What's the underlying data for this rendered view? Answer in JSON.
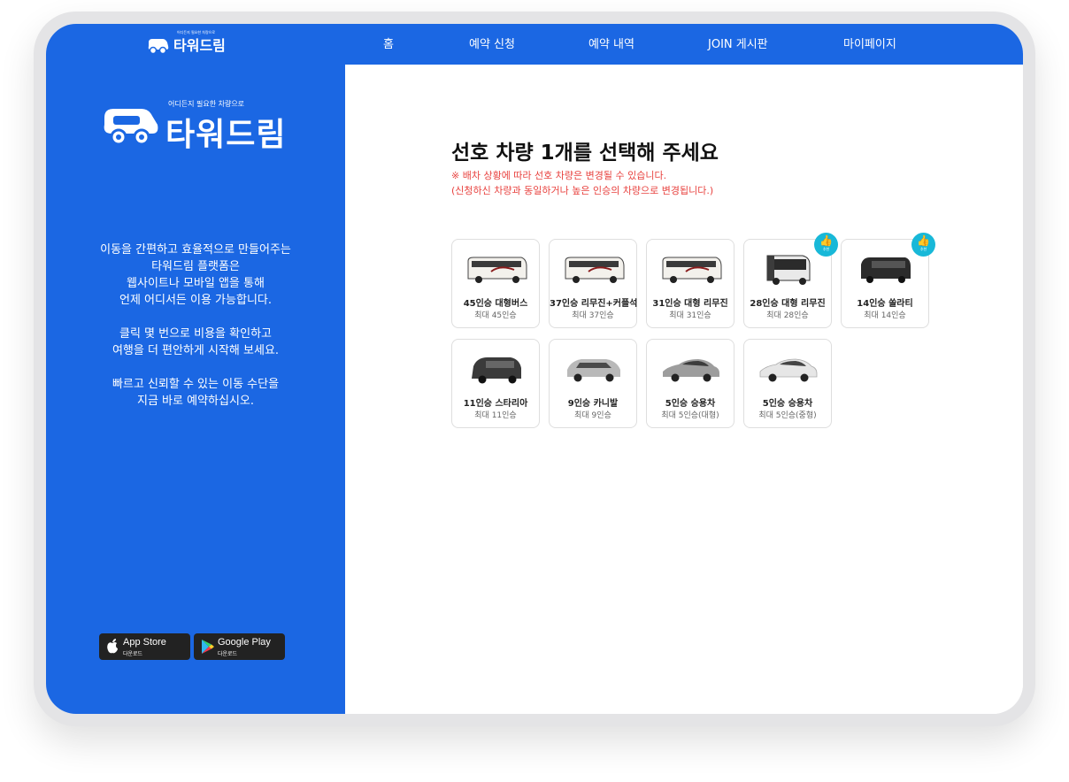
{
  "brand": {
    "name": "타워드림",
    "tagline": "어디든지 필요한 차량으로"
  },
  "nav": {
    "items": [
      "홈",
      "예약 신청",
      "예약 내역",
      "JOIN 게시판",
      "마이페이지"
    ]
  },
  "sidebar": {
    "paragraphs": [
      "이동을 간편하고 효율적으로 만들어주는\n타워드림 플랫폼은\n웹사이트나 모바일 앱을 통해\n언제 어디서든 이용 가능합니다.",
      "클릭 몇 번으로 비용을 확인하고\n여행을 더 편안하게 시작해 보세요.",
      "빠르고 신뢰할 수 있는 이동 수단을\n지금 바로 예약하십시오."
    ],
    "stores": [
      {
        "title": "App Store",
        "sub": "다운로드",
        "icon": "apple-icon"
      },
      {
        "title": "Google Play",
        "sub": "다운로드",
        "icon": "google-play-icon"
      }
    ]
  },
  "main": {
    "heading": "선호 차량 1개를 선택해 주세요",
    "notice_1": "※ 배차 상황에 따라 선호 차량은 변경될 수 있습니다.",
    "notice_2": "(신청하신 차량과 동일하거나 높은 인승의 차량으로 변경됩니다.)",
    "badge_label": "추천",
    "vehicles": [
      {
        "name": "45인승 대형버스",
        "capacity": "최대 45인승",
        "type": "bus",
        "recommended": false
      },
      {
        "name": "37인승 리무진+커플석",
        "capacity": "최대 37인승",
        "type": "bus",
        "recommended": false
      },
      {
        "name": "31인승 대형 리무진",
        "capacity": "최대 31인승",
        "type": "bus",
        "recommended": false
      },
      {
        "name": "28인승 대형 리무진",
        "capacity": "최대 28인승",
        "type": "coach",
        "recommended": true
      },
      {
        "name": "14인승 쏠라티",
        "capacity": "최대 14인승",
        "type": "van",
        "recommended": true
      },
      {
        "name": "11인승 스타리아",
        "capacity": "최대 11인승",
        "type": "minivan",
        "recommended": false
      },
      {
        "name": "9인승 카니발",
        "capacity": "최대 9인승",
        "type": "suv",
        "recommended": false
      },
      {
        "name": "5인승 승용차",
        "capacity": "최대 5인승(대형)",
        "type": "sedan",
        "recommended": false
      },
      {
        "name": "5인승 승용차",
        "capacity": "최대 5인승(중형)",
        "type": "sedan-white",
        "recommended": false
      }
    ]
  },
  "colors": {
    "brand_blue": "#1b67e3",
    "notice_red": "#e8423f",
    "badge_cyan": "#18b8d8"
  }
}
